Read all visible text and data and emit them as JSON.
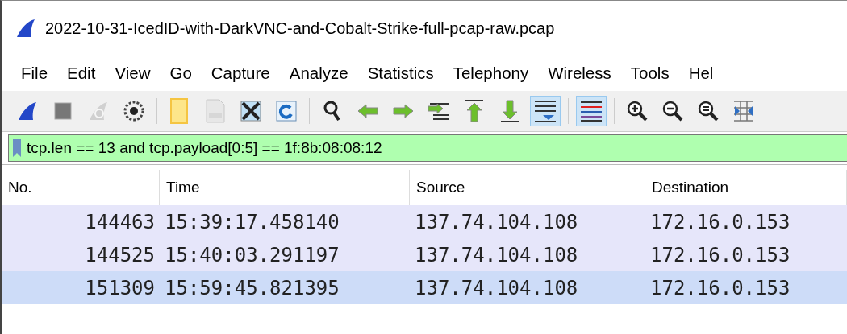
{
  "window": {
    "title": "2022-10-31-IcedID-with-DarkVNC-and-Cobalt-Strike-full-pcap-raw.pcap"
  },
  "menu": [
    "File",
    "Edit",
    "View",
    "Go",
    "Capture",
    "Analyze",
    "Statistics",
    "Telephony",
    "Wireless",
    "Tools",
    "Hel"
  ],
  "toolbar": {
    "groups": [
      [
        {
          "pressed": false,
          "disabled": false
        },
        {
          "pressed": false,
          "disabled": false
        },
        {
          "pressed": false,
          "disabled": true
        },
        {
          "pressed": false,
          "disabled": false
        }
      ],
      [
        {
          "pressed": false,
          "disabled": false
        },
        {
          "pressed": false,
          "disabled": true
        },
        {
          "pressed": false,
          "disabled": false
        },
        {
          "pressed": false,
          "disabled": false
        }
      ],
      [
        {
          "pressed": false,
          "disabled": false
        },
        {
          "pressed": false,
          "disabled": false
        },
        {
          "pressed": false,
          "disabled": false
        },
        {
          "pressed": false,
          "disabled": false
        },
        {
          "pressed": false,
          "disabled": false
        },
        {
          "pressed": false,
          "disabled": false
        },
        {
          "pressed": true,
          "disabled": false
        }
      ],
      [
        {
          "pressed": true,
          "disabled": false
        }
      ],
      [
        {
          "pressed": false,
          "disabled": false
        },
        {
          "pressed": false,
          "disabled": false
        },
        {
          "pressed": false,
          "disabled": false
        },
        {
          "pressed": false,
          "disabled": false
        }
      ]
    ]
  },
  "filter": {
    "value": "tcp.len == 13 and tcp.payload[0:5] == 1f:8b:08:08:12",
    "valid": true
  },
  "table": {
    "columns": [
      "No.",
      "Time",
      "Source",
      "Destination"
    ],
    "rows": [
      {
        "cells": [
          "144463",
          "15:39:17.458140",
          "137.74.104.108",
          "172.16.0.153"
        ],
        "selected": false
      },
      {
        "cells": [
          "144525",
          "15:40:03.291197",
          "137.74.104.108",
          "172.16.0.153"
        ],
        "selected": false
      },
      {
        "cells": [
          "151309",
          "15:59:45.821395",
          "137.74.104.108",
          "172.16.0.153"
        ],
        "selected": true
      }
    ]
  }
}
